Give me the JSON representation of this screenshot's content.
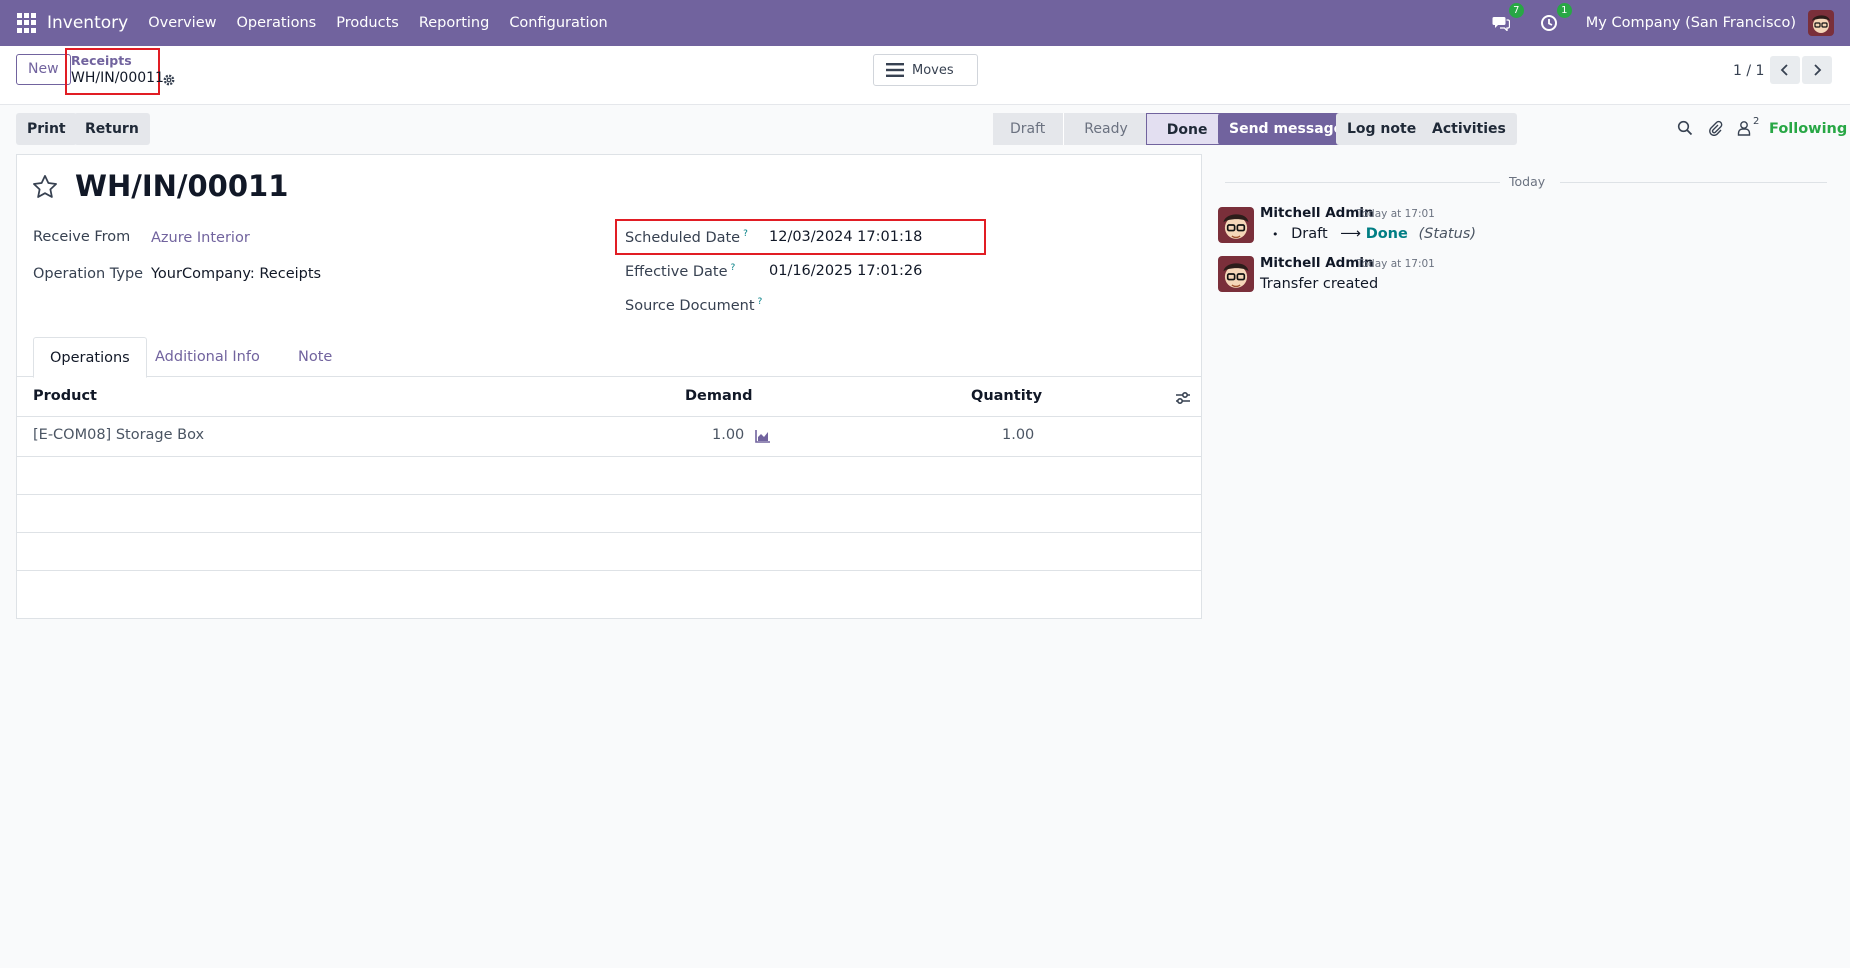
{
  "navbar": {
    "app_name": "Inventory",
    "menu": [
      "Overview",
      "Operations",
      "Products",
      "Reporting",
      "Configuration"
    ],
    "messages_badge": "7",
    "activities_badge": "1",
    "company": "My Company (San Francisco)",
    "accent_color": "#71639e"
  },
  "control": {
    "new_label": "New",
    "breadcrumb_parent": "Receipts",
    "breadcrumb_current": "WH/IN/00011",
    "moves_label": "Moves",
    "pager": "1 / 1"
  },
  "actions": {
    "print_label": "Print",
    "return_label": "Return"
  },
  "status": {
    "stages": [
      "Draft",
      "Ready",
      "Done"
    ],
    "active": "Done"
  },
  "form": {
    "title": "WH/IN/00011",
    "receive_from_label": "Receive From",
    "receive_from_value": "Azure Interior",
    "operation_type_label": "Operation Type",
    "operation_type_value": "YourCompany: Receipts",
    "scheduled_date_label": "Scheduled Date",
    "scheduled_date_value": "12/03/2024 17:01:18",
    "effective_date_label": "Effective Date",
    "effective_date_value": "01/16/2025 17:01:26",
    "source_document_label": "Source Document",
    "help_mark": "?"
  },
  "tabs": [
    "Operations",
    "Additional Info",
    "Note"
  ],
  "table": {
    "headers": {
      "product": "Product",
      "demand": "Demand",
      "quantity": "Quantity"
    },
    "rows": [
      {
        "product": "[E-COM08] Storage Box",
        "demand": "1.00",
        "quantity": "1.00"
      }
    ]
  },
  "chatter": {
    "send_message": "Send message",
    "log_note": "Log note",
    "activities": "Activities",
    "followers_count": "2",
    "following": "Following",
    "date_separator": "Today",
    "messages": [
      {
        "author": "Mitchell Admin",
        "time": "Today at 17:01",
        "from_status": "Draft",
        "arrow": "⟶",
        "to_status": "Done",
        "field": "(Status)"
      },
      {
        "author": "Mitchell Admin",
        "time": "Today at 17:01",
        "body": "Transfer created"
      }
    ]
  }
}
